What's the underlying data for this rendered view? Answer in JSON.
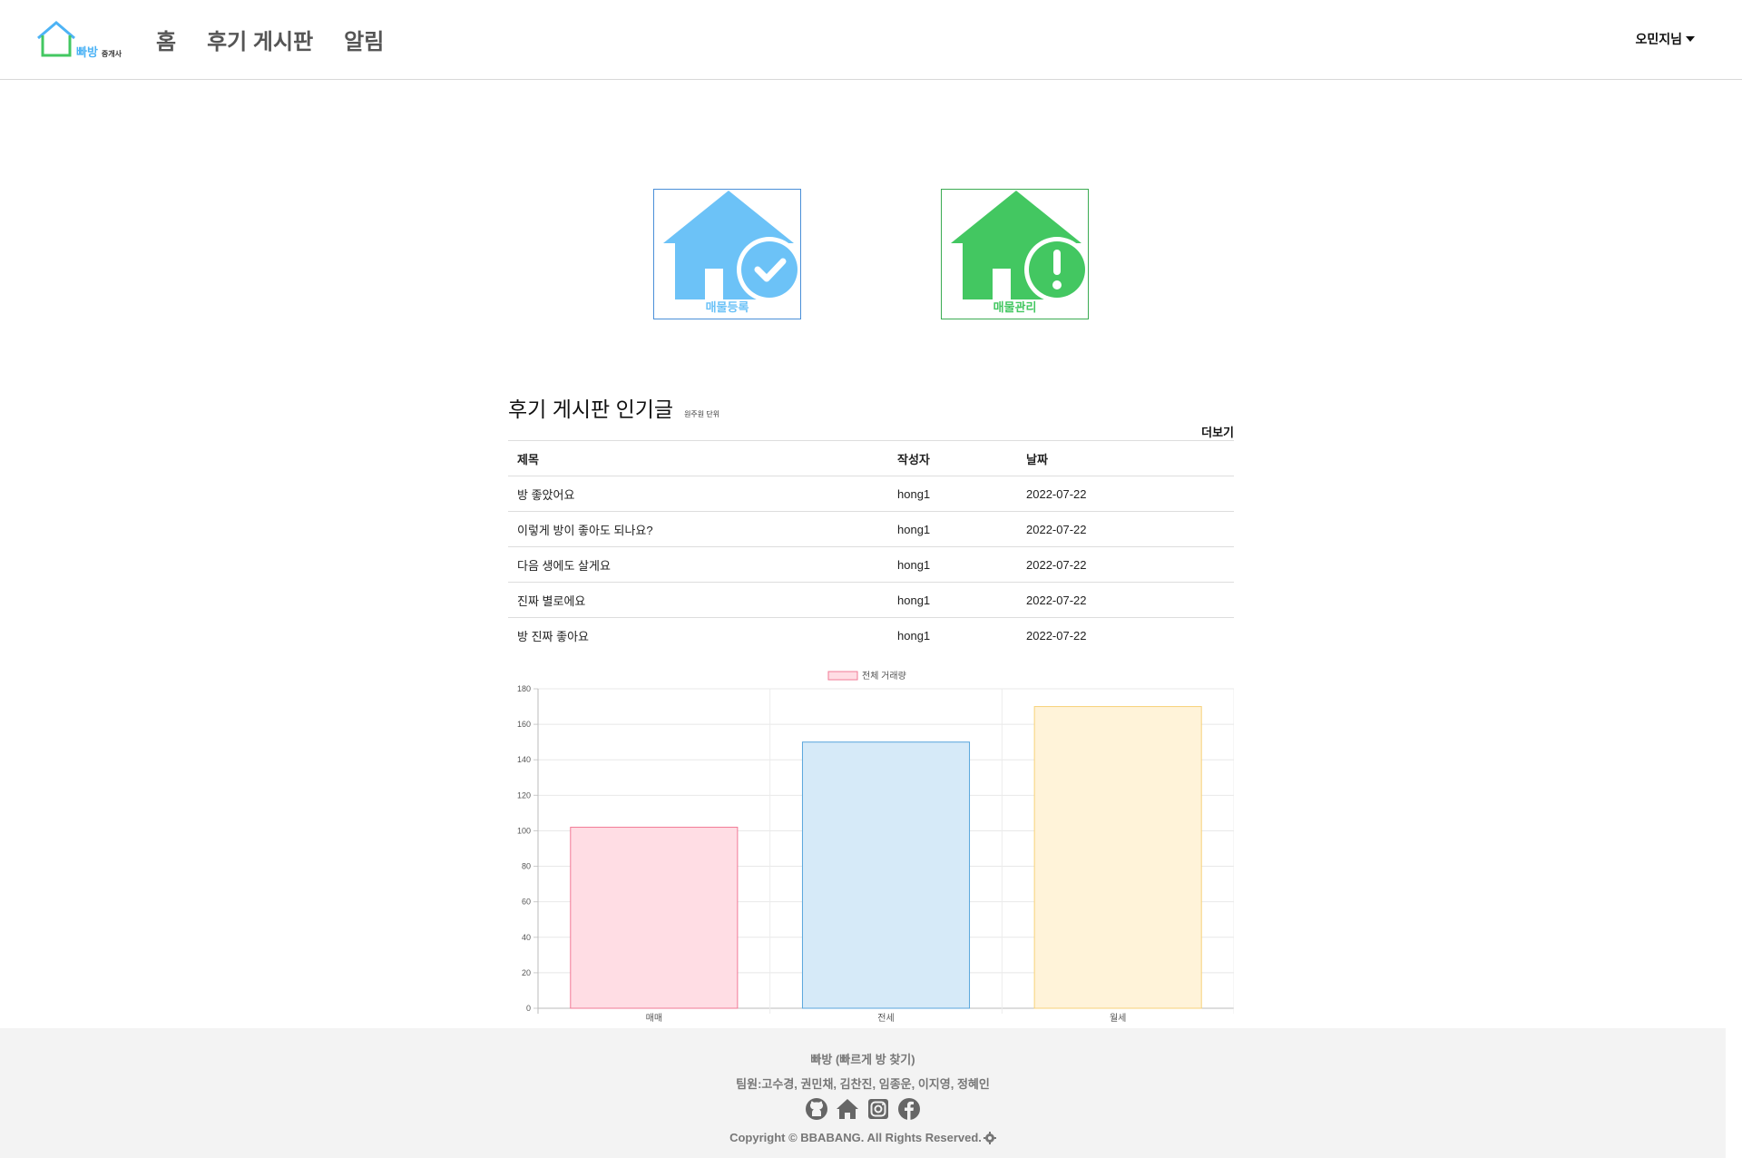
{
  "header": {
    "logo_text": "빠방",
    "logo_sub": "중개사",
    "nav": [
      "홈",
      "후기 게시판",
      "알림"
    ],
    "user": "오민지님"
  },
  "tiles": {
    "register": "매물등록",
    "manage": "매물관리",
    "register_color": "#6cc2f7",
    "manage_color": "#43c761"
  },
  "board": {
    "title": "후기 게시판 인기글",
    "unit": "원주원 단위",
    "more": "더보기",
    "columns": [
      "제목",
      "작성자",
      "날짜"
    ],
    "rows": [
      {
        "title": "방 좋았어요",
        "author": "hong1",
        "date": "2022-07-22"
      },
      {
        "title": "이렇게 방이 좋아도 되나요?",
        "author": "hong1",
        "date": "2022-07-22"
      },
      {
        "title": "다음 생에도 살게요",
        "author": "hong1",
        "date": "2022-07-22"
      },
      {
        "title": "진짜 별로에요",
        "author": "hong1",
        "date": "2022-07-22"
      },
      {
        "title": "방 진짜 좋아요",
        "author": "hong1",
        "date": "2022-07-22"
      }
    ]
  },
  "chart_data": {
    "type": "bar",
    "categories": [
      "매매",
      "전세",
      "월세"
    ],
    "series": [
      {
        "name": "전체 거래량",
        "values": [
          102,
          150,
          170
        ]
      }
    ],
    "ylim": [
      0,
      180
    ],
    "yticks": [
      0,
      20,
      40,
      60,
      80,
      100,
      120,
      140,
      160,
      180
    ],
    "legend": "top",
    "grid": true,
    "bar_fills": [
      "#ffdde4",
      "#d6eaf8",
      "#fff3d9"
    ],
    "bar_strokes": [
      "#f27a96",
      "#59a6dc",
      "#f7d27a"
    ]
  },
  "footer": {
    "title": "빠방 (빠르게 방 찾기)",
    "team": "팀원:고수경, 권민채, 김찬진, 임종운, 이지영, 정혜인",
    "copyright": "Copyright © BBABANG. All Rights Reserved."
  }
}
